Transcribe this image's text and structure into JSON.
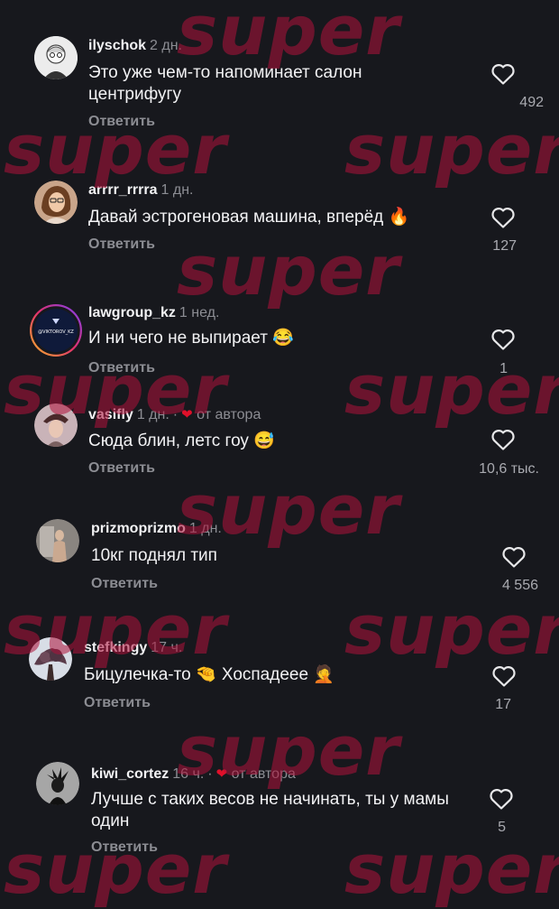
{
  "watermark": "super",
  "comments": [
    {
      "user": "ilyschok",
      "time": "2 дн.",
      "text": "Это уже чем-то напоминает салон центрифугу",
      "emoji": "",
      "reply": "Ответить",
      "likes": "492",
      "author_liked": false
    },
    {
      "user": "arrrr_rrrra",
      "time": "1 дн.",
      "text": "Давай эстрогеновая машина, вперёд",
      "emoji": "🔥",
      "reply": "Ответить",
      "likes": "127",
      "author_liked": false
    },
    {
      "user": "lawgroup_kz",
      "time": "1 нед.",
      "text": "И ни чего не выпирает",
      "emoji": "😂",
      "reply": "Ответить",
      "likes": "1",
      "author_liked": false,
      "avatar_text": "@VIKTOROV_KZ"
    },
    {
      "user": "vasifly",
      "time": "1 дн.",
      "text": "Сюда блин, летс гоу",
      "emoji": "😅",
      "reply": "Ответить",
      "likes": "10,6 тыс.",
      "author_liked": true,
      "author_label": "от автора"
    },
    {
      "user": "prizmoprizmo",
      "time": "1 дн.",
      "text": "10кг поднял тип",
      "emoji": "",
      "reply": "Ответить",
      "likes": "4 556",
      "author_liked": false
    },
    {
      "user": "stefkingy",
      "time": "17 ч.",
      "text": "Бицулечка-то 🤏 Хоспадеее",
      "emoji": "🤦",
      "reply": "Ответить",
      "likes": "17",
      "author_liked": false
    },
    {
      "user": "kiwi_cortez",
      "time": "16 ч.",
      "text": "Лучше с таких весов не начинать, ты у мамы один",
      "emoji": "",
      "reply": "Ответить",
      "likes": "5",
      "author_liked": true,
      "author_label": "от автора"
    }
  ],
  "colors": {
    "background": "#17181d",
    "watermark": "#b0123b",
    "author_heart": "#e0102a"
  }
}
